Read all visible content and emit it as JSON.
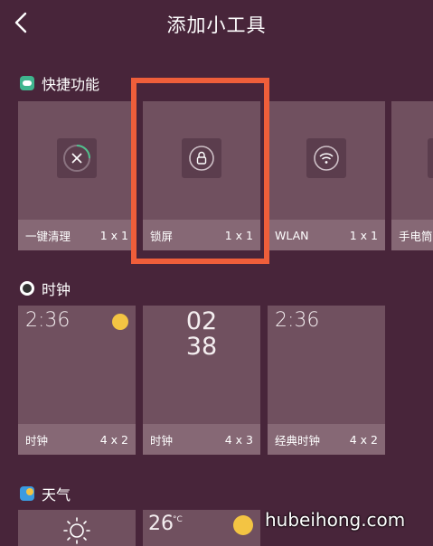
{
  "header": {
    "title": "添加小工具"
  },
  "sections": {
    "shortcuts": {
      "title": "快捷功能",
      "cards": [
        {
          "label": "一键清理",
          "size": "1 x 1",
          "icon": "clean-icon"
        },
        {
          "label": "锁屏",
          "size": "1 x 1",
          "icon": "lock-icon"
        },
        {
          "label": "WLAN",
          "size": "1 x 1",
          "icon": "wifi-icon"
        },
        {
          "label": "手电筒",
          "size": "",
          "icon": "flashlight-icon"
        }
      ]
    },
    "clock": {
      "title": "时钟",
      "cards": [
        {
          "label": "时钟",
          "size": "4 x 2",
          "time": "2:36"
        },
        {
          "label": "时钟",
          "size": "4 x 3",
          "hour": "02",
          "minute": "38"
        },
        {
          "label": "经典时钟",
          "size": "4 x 2",
          "time": "2:36"
        }
      ]
    },
    "weather": {
      "title": "天气",
      "cards": [
        {
          "icon": "sun-outline-icon"
        },
        {
          "temp": "26",
          "unit": "°C"
        }
      ]
    }
  },
  "watermark": "hubeihong.com",
  "colors": {
    "background": "#48253a",
    "card": "#70505f",
    "card_footer": "#866875",
    "highlight": "#ef5e3a",
    "sun": "#f3c443"
  }
}
